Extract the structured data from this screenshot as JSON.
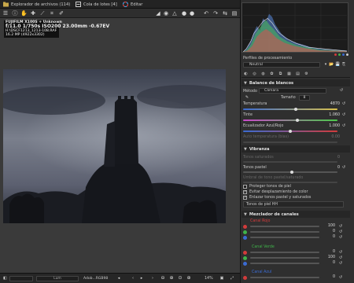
{
  "tabs": {
    "file_browser": "Explorador de archivos (114)",
    "batch_queue": "Cola de lotes [4]",
    "editor": "Editar"
  },
  "exif": {
    "line1": "FUJIFILM X100S + Unknown",
    "f": "f/11.0",
    "shutter": "1/750s",
    "iso": "ISO200",
    "focal": "23.00mm",
    "ev": "-0.67EV",
    "file": "H:\\DSCF1213_1213-108.RAF",
    "mp": "16.2 MP (4922x3302)"
  },
  "bottombar": {
    "zoom_field": "Lum",
    "profile_field": "Adob...RGB98",
    "zoom_level": "14%"
  },
  "panel": {
    "processing_profiles_label": "Perfiles de procesamiento",
    "profile_value": "Neutral",
    "white_balance_title": "Balance de blancos",
    "method_label": "Método",
    "method_value": "Cámara",
    "size_label": "Tamaño",
    "size_value": "8",
    "temperature_label": "Temperatura",
    "temperature_value": "4870",
    "tint_label": "Tinte",
    "tint_value": "1.060",
    "blue_red_label": "Ecualizador Azul/Rojo",
    "blue_red_value": "1.000",
    "auto_temp_label": "Auto temperatura (bias)",
    "auto_temp_value": "0.00",
    "vibrance_title": "Vibranza",
    "saturated_label": "Tonos saturados",
    "saturated_value": "0",
    "pastel_label": "Tonos pastel",
    "pastel_value": "0",
    "threshold_label": "Umbral de tono pastel/saturado",
    "threshold_value": "75",
    "protect_skin": "Proteger tonos de piel",
    "avoid_shift": "Evitar desplazamiento de color",
    "link_tones": "Enlazar tonos pastel y saturados",
    "curve_label": "Tonos de piel HH",
    "mixer_title": "Mezclador de canales",
    "red_channel": "Canal Rojo",
    "green_channel": "Canal Verde",
    "blue_channel": "Canal Azul",
    "mixer_values": [
      "100",
      "0",
      "0",
      "0",
      "100",
      "0",
      "0",
      "0",
      "100"
    ]
  },
  "colors": {
    "accent": "#7b8fb8",
    "red": "#d23b3b",
    "green": "#3fb34a",
    "blue": "#3b6bd2"
  }
}
